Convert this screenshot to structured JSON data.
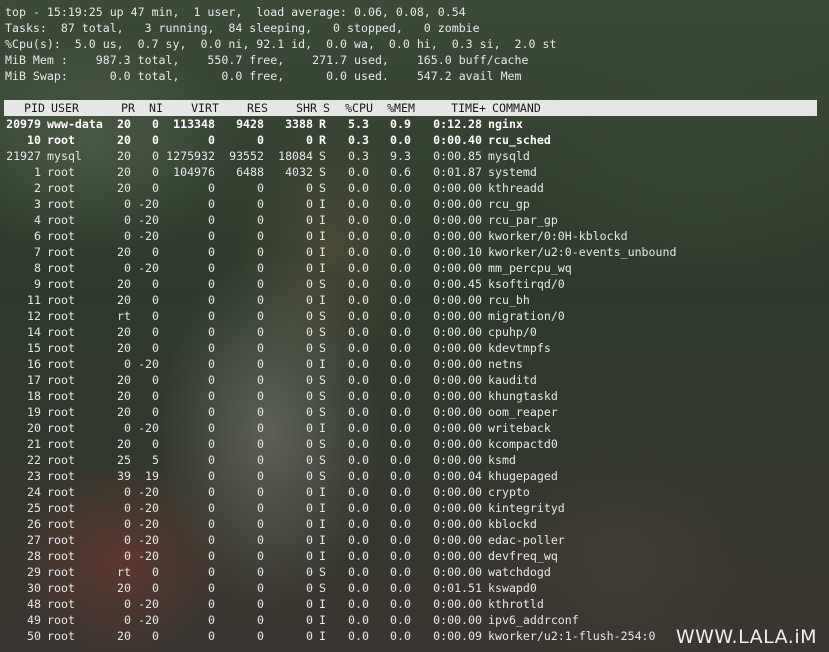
{
  "summary": [
    "top - 15:19:25 up 47 min,  1 user,  load average: 0.06, 0.08, 0.54",
    "Tasks:  87 total,   3 running,  84 sleeping,   0 stopped,   0 zombie",
    "%Cpu(s):  5.0 us,  0.7 sy,  0.0 ni, 92.1 id,  0.0 wa,  0.0 hi,  0.3 si,  2.0 st",
    "MiB Mem :    987.3 total,    550.7 free,    271.7 used,    165.0 buff/cache",
    "MiB Swap:      0.0 total,      0.0 free,      0.0 used.    547.2 avail Mem"
  ],
  "headers": {
    "pid": "PID",
    "user": "USER",
    "pr": "PR",
    "ni": "NI",
    "virt": "VIRT",
    "res": "RES",
    "shr": "SHR",
    "s": "S",
    "cpu": "%CPU",
    "mem": "%MEM",
    "time": "TIME+",
    "cmd": "COMMAND"
  },
  "processes": [
    {
      "pid": "20979",
      "user": "www-data",
      "pr": "20",
      "ni": "0",
      "virt": "113348",
      "res": "9428",
      "shr": "3388",
      "s": "R",
      "cpu": "5.3",
      "mem": "0.9",
      "time": "0:12.28",
      "cmd": "nginx",
      "bold": true
    },
    {
      "pid": "10",
      "user": "root",
      "pr": "20",
      "ni": "0",
      "virt": "0",
      "res": "0",
      "shr": "0",
      "s": "R",
      "cpu": "0.3",
      "mem": "0.0",
      "time": "0:00.40",
      "cmd": "rcu_sched",
      "bold": true
    },
    {
      "pid": "21927",
      "user": "mysql",
      "pr": "20",
      "ni": "0",
      "virt": "1275932",
      "res": "93552",
      "shr": "18084",
      "s": "S",
      "cpu": "0.3",
      "mem": "9.3",
      "time": "0:00.85",
      "cmd": "mysqld"
    },
    {
      "pid": "1",
      "user": "root",
      "pr": "20",
      "ni": "0",
      "virt": "104976",
      "res": "6488",
      "shr": "4032",
      "s": "S",
      "cpu": "0.0",
      "mem": "0.6",
      "time": "0:01.87",
      "cmd": "systemd"
    },
    {
      "pid": "2",
      "user": "root",
      "pr": "20",
      "ni": "0",
      "virt": "0",
      "res": "0",
      "shr": "0",
      "s": "S",
      "cpu": "0.0",
      "mem": "0.0",
      "time": "0:00.00",
      "cmd": "kthreadd"
    },
    {
      "pid": "3",
      "user": "root",
      "pr": "0",
      "ni": "-20",
      "virt": "0",
      "res": "0",
      "shr": "0",
      "s": "I",
      "cpu": "0.0",
      "mem": "0.0",
      "time": "0:00.00",
      "cmd": "rcu_gp"
    },
    {
      "pid": "4",
      "user": "root",
      "pr": "0",
      "ni": "-20",
      "virt": "0",
      "res": "0",
      "shr": "0",
      "s": "I",
      "cpu": "0.0",
      "mem": "0.0",
      "time": "0:00.00",
      "cmd": "rcu_par_gp"
    },
    {
      "pid": "6",
      "user": "root",
      "pr": "0",
      "ni": "-20",
      "virt": "0",
      "res": "0",
      "shr": "0",
      "s": "I",
      "cpu": "0.0",
      "mem": "0.0",
      "time": "0:00.00",
      "cmd": "kworker/0:0H-kblockd"
    },
    {
      "pid": "7",
      "user": "root",
      "pr": "20",
      "ni": "0",
      "virt": "0",
      "res": "0",
      "shr": "0",
      "s": "I",
      "cpu": "0.0",
      "mem": "0.0",
      "time": "0:00.10",
      "cmd": "kworker/u2:0-events_unbound"
    },
    {
      "pid": "8",
      "user": "root",
      "pr": "0",
      "ni": "-20",
      "virt": "0",
      "res": "0",
      "shr": "0",
      "s": "I",
      "cpu": "0.0",
      "mem": "0.0",
      "time": "0:00.00",
      "cmd": "mm_percpu_wq"
    },
    {
      "pid": "9",
      "user": "root",
      "pr": "20",
      "ni": "0",
      "virt": "0",
      "res": "0",
      "shr": "0",
      "s": "S",
      "cpu": "0.0",
      "mem": "0.0",
      "time": "0:00.45",
      "cmd": "ksoftirqd/0"
    },
    {
      "pid": "11",
      "user": "root",
      "pr": "20",
      "ni": "0",
      "virt": "0",
      "res": "0",
      "shr": "0",
      "s": "I",
      "cpu": "0.0",
      "mem": "0.0",
      "time": "0:00.00",
      "cmd": "rcu_bh"
    },
    {
      "pid": "12",
      "user": "root",
      "pr": "rt",
      "ni": "0",
      "virt": "0",
      "res": "0",
      "shr": "0",
      "s": "S",
      "cpu": "0.0",
      "mem": "0.0",
      "time": "0:00.00",
      "cmd": "migration/0"
    },
    {
      "pid": "14",
      "user": "root",
      "pr": "20",
      "ni": "0",
      "virt": "0",
      "res": "0",
      "shr": "0",
      "s": "S",
      "cpu": "0.0",
      "mem": "0.0",
      "time": "0:00.00",
      "cmd": "cpuhp/0"
    },
    {
      "pid": "15",
      "user": "root",
      "pr": "20",
      "ni": "0",
      "virt": "0",
      "res": "0",
      "shr": "0",
      "s": "S",
      "cpu": "0.0",
      "mem": "0.0",
      "time": "0:00.00",
      "cmd": "kdevtmpfs"
    },
    {
      "pid": "16",
      "user": "root",
      "pr": "0",
      "ni": "-20",
      "virt": "0",
      "res": "0",
      "shr": "0",
      "s": "I",
      "cpu": "0.0",
      "mem": "0.0",
      "time": "0:00.00",
      "cmd": "netns"
    },
    {
      "pid": "17",
      "user": "root",
      "pr": "20",
      "ni": "0",
      "virt": "0",
      "res": "0",
      "shr": "0",
      "s": "S",
      "cpu": "0.0",
      "mem": "0.0",
      "time": "0:00.00",
      "cmd": "kauditd"
    },
    {
      "pid": "18",
      "user": "root",
      "pr": "20",
      "ni": "0",
      "virt": "0",
      "res": "0",
      "shr": "0",
      "s": "S",
      "cpu": "0.0",
      "mem": "0.0",
      "time": "0:00.00",
      "cmd": "khungtaskd"
    },
    {
      "pid": "19",
      "user": "root",
      "pr": "20",
      "ni": "0",
      "virt": "0",
      "res": "0",
      "shr": "0",
      "s": "S",
      "cpu": "0.0",
      "mem": "0.0",
      "time": "0:00.00",
      "cmd": "oom_reaper"
    },
    {
      "pid": "20",
      "user": "root",
      "pr": "0",
      "ni": "-20",
      "virt": "0",
      "res": "0",
      "shr": "0",
      "s": "I",
      "cpu": "0.0",
      "mem": "0.0",
      "time": "0:00.00",
      "cmd": "writeback"
    },
    {
      "pid": "21",
      "user": "root",
      "pr": "20",
      "ni": "0",
      "virt": "0",
      "res": "0",
      "shr": "0",
      "s": "S",
      "cpu": "0.0",
      "mem": "0.0",
      "time": "0:00.00",
      "cmd": "kcompactd0"
    },
    {
      "pid": "22",
      "user": "root",
      "pr": "25",
      "ni": "5",
      "virt": "0",
      "res": "0",
      "shr": "0",
      "s": "S",
      "cpu": "0.0",
      "mem": "0.0",
      "time": "0:00.00",
      "cmd": "ksmd"
    },
    {
      "pid": "23",
      "user": "root",
      "pr": "39",
      "ni": "19",
      "virt": "0",
      "res": "0",
      "shr": "0",
      "s": "S",
      "cpu": "0.0",
      "mem": "0.0",
      "time": "0:00.04",
      "cmd": "khugepaged"
    },
    {
      "pid": "24",
      "user": "root",
      "pr": "0",
      "ni": "-20",
      "virt": "0",
      "res": "0",
      "shr": "0",
      "s": "I",
      "cpu": "0.0",
      "mem": "0.0",
      "time": "0:00.00",
      "cmd": "crypto"
    },
    {
      "pid": "25",
      "user": "root",
      "pr": "0",
      "ni": "-20",
      "virt": "0",
      "res": "0",
      "shr": "0",
      "s": "I",
      "cpu": "0.0",
      "mem": "0.0",
      "time": "0:00.00",
      "cmd": "kintegrityd"
    },
    {
      "pid": "26",
      "user": "root",
      "pr": "0",
      "ni": "-20",
      "virt": "0",
      "res": "0",
      "shr": "0",
      "s": "I",
      "cpu": "0.0",
      "mem": "0.0",
      "time": "0:00.00",
      "cmd": "kblockd"
    },
    {
      "pid": "27",
      "user": "root",
      "pr": "0",
      "ni": "-20",
      "virt": "0",
      "res": "0",
      "shr": "0",
      "s": "I",
      "cpu": "0.0",
      "mem": "0.0",
      "time": "0:00.00",
      "cmd": "edac-poller"
    },
    {
      "pid": "28",
      "user": "root",
      "pr": "0",
      "ni": "-20",
      "virt": "0",
      "res": "0",
      "shr": "0",
      "s": "I",
      "cpu": "0.0",
      "mem": "0.0",
      "time": "0:00.00",
      "cmd": "devfreq_wq"
    },
    {
      "pid": "29",
      "user": "root",
      "pr": "rt",
      "ni": "0",
      "virt": "0",
      "res": "0",
      "shr": "0",
      "s": "S",
      "cpu": "0.0",
      "mem": "0.0",
      "time": "0:00.00",
      "cmd": "watchdogd"
    },
    {
      "pid": "30",
      "user": "root",
      "pr": "20",
      "ni": "0",
      "virt": "0",
      "res": "0",
      "shr": "0",
      "s": "S",
      "cpu": "0.0",
      "mem": "0.0",
      "time": "0:01.51",
      "cmd": "kswapd0"
    },
    {
      "pid": "48",
      "user": "root",
      "pr": "0",
      "ni": "-20",
      "virt": "0",
      "res": "0",
      "shr": "0",
      "s": "I",
      "cpu": "0.0",
      "mem": "0.0",
      "time": "0:00.00",
      "cmd": "kthrotld"
    },
    {
      "pid": "49",
      "user": "root",
      "pr": "0",
      "ni": "-20",
      "virt": "0",
      "res": "0",
      "shr": "0",
      "s": "I",
      "cpu": "0.0",
      "mem": "0.0",
      "time": "0:00.00",
      "cmd": "ipv6_addrconf"
    },
    {
      "pid": "50",
      "user": "root",
      "pr": "20",
      "ni": "0",
      "virt": "0",
      "res": "0",
      "shr": "0",
      "s": "I",
      "cpu": "0.0",
      "mem": "0.0",
      "time": "0:00.09",
      "cmd": "kworker/u2:1-flush-254:0"
    }
  ],
  "watermark": "WWW.LALA.iM"
}
